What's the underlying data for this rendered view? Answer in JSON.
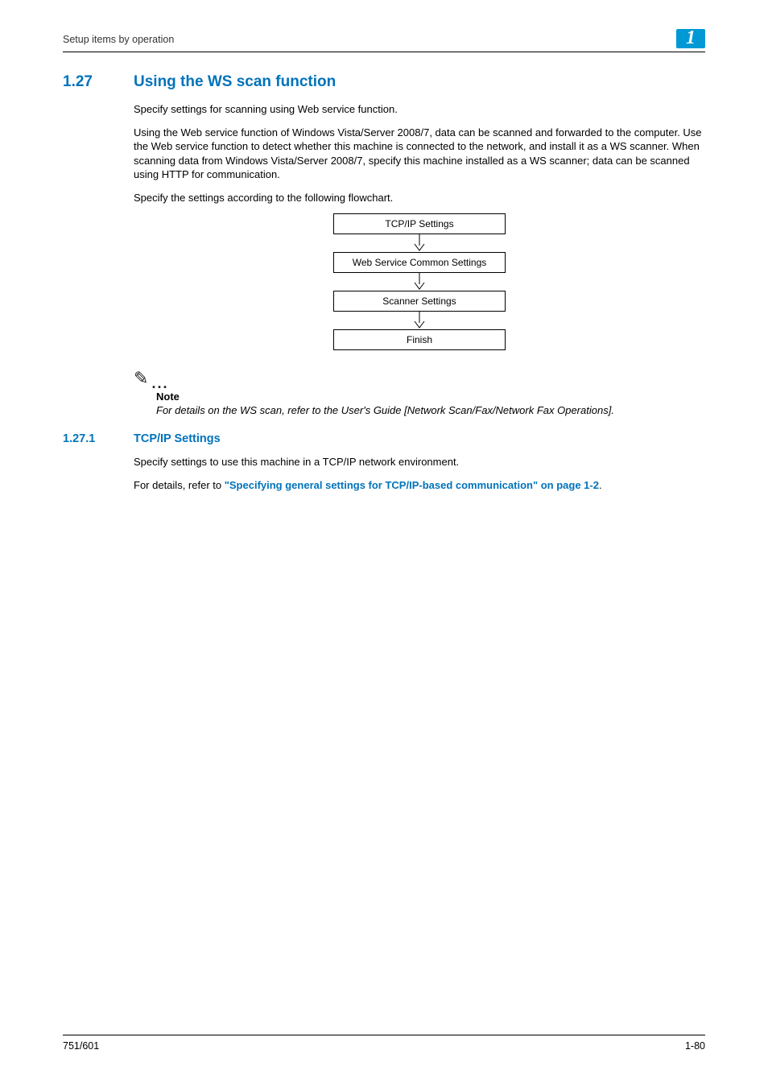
{
  "header": {
    "running_title": "Setup items by operation",
    "chapter_num": "1"
  },
  "section": {
    "num": "1.27",
    "title": "Using the WS scan function",
    "p1": "Specify settings for scanning using Web service function.",
    "p2": "Using the Web service function of Windows Vista/Server 2008/7, data can be scanned and forwarded to the computer. Use the Web service function to detect whether this machine is connected to the network, and install it as a WS scanner. When scanning data from Windows Vista/Server 2008/7, specify this machine installed as a WS scanner; data can be scanned using HTTP for communication.",
    "p3": "Specify the settings according to the following flowchart."
  },
  "flowchart": {
    "step1": "TCP/IP Settings",
    "step2": "Web Service Common Settings",
    "step3": "Scanner Settings",
    "step4": "Finish"
  },
  "note": {
    "label": "Note",
    "text": "For details on the WS scan, refer to the User's Guide [Network Scan/Fax/Network Fax Operations]."
  },
  "subsection": {
    "num": "1.27.1",
    "title": "TCP/IP Settings",
    "p1": "Specify settings to use this machine in a TCP/IP network environment.",
    "p2_pre": "For details, refer to ",
    "p2_link": "\"Specifying general settings for TCP/IP-based communication\" on page 1-2",
    "p2_post": "."
  },
  "footer": {
    "left": "751/601",
    "right": "1-80"
  }
}
